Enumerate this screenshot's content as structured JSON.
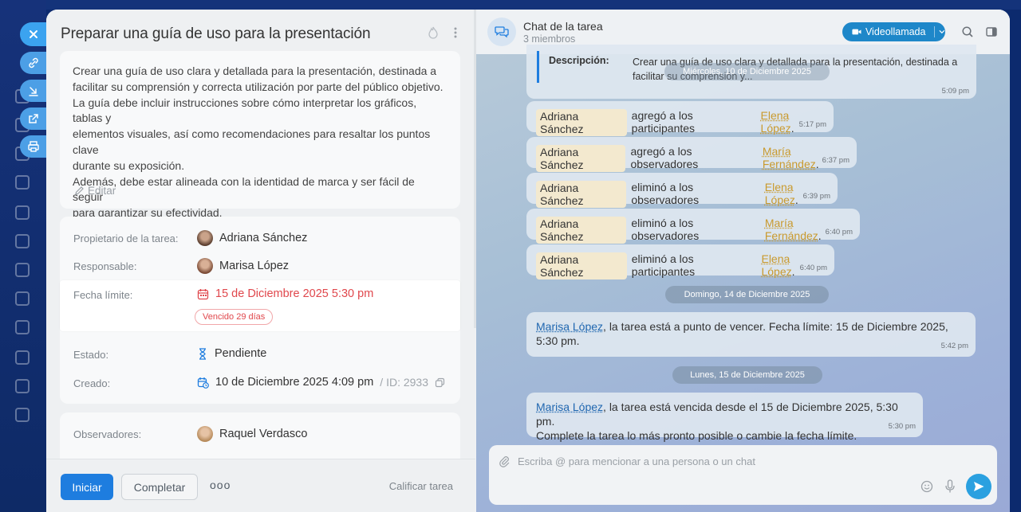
{
  "task": {
    "title": "Preparar una guía de uso para la presentación",
    "description": "Crear una guía de uso clara y detallada para la presentación, destinada a\nfacilitar su comprensión y correcta utilización por parte del público objetivo.\nLa guía debe incluir instrucciones sobre cómo interpretar los gráficos, tablas y\nelementos visuales, así como recomendaciones para resaltar los puntos clave\ndurante su exposición.\nAdemás, debe estar alineada con la identidad de marca y ser fácil de seguir\npara garantizar su efectividad.",
    "edit_label": "Editar",
    "fields": {
      "owner_label": "Propietario de la tarea:",
      "owner_value": "Adriana Sánchez",
      "responsible_label": "Responsable:",
      "responsible_value": "Marisa López",
      "deadline_label": "Fecha límite:",
      "deadline_value": "15 de Diciembre 2025 5:30 pm",
      "overdue_badge": "Vencido 29 días",
      "status_label": "Estado:",
      "status_value": "Pendiente",
      "created_label": "Creado:",
      "created_value": "10 de Diciembre 2025 4:09 pm",
      "created_id": "/ ID: 2933",
      "observers_label": "Observadores:",
      "observers_value": "Raquel Verdasco"
    },
    "footer": {
      "start": "Iniciar",
      "complete": "Completar",
      "more": "ooo",
      "rate": "Calificar tarea"
    }
  },
  "chat": {
    "title": "Chat de la tarea",
    "members": "3 miembros",
    "video_button": "Videollamada",
    "description_label": "Descripción:",
    "description_text": "Crear una guía de uso clara y detallada para la presentación, destinada a facilitar su comprensión y...",
    "description_time": "5:09 pm",
    "date_wednesday": "Miércoles, 10 de Diciembre 2025",
    "date_sunday": "Domingo, 14 de Diciembre 2025",
    "date_monday": "Lunes, 15 de Diciembre 2025",
    "system_messages": [
      {
        "actor": "Adriana Sánchez",
        "action": "agregó a los participantes",
        "target": "Elena López",
        "time": "5:17 pm"
      },
      {
        "actor": "Adriana Sánchez",
        "action": "agregó a los observadores",
        "target": "María Fernández",
        "time": "6:37 pm"
      },
      {
        "actor": "Adriana Sánchez",
        "action": "eliminó a los observadores",
        "target": "Elena López",
        "time": "6:39 pm"
      },
      {
        "actor": "Adriana Sánchez",
        "action": "eliminó a los observadores",
        "target": "María Fernández",
        "time": "6:40 pm"
      },
      {
        "actor": "Adriana Sánchez",
        "action": "eliminó a los participantes",
        "target": "Elena López",
        "time": "6:40 pm"
      }
    ],
    "msg_due_soon": {
      "name": "Marisa López",
      "text": ", la tarea está a punto de vencer. Fecha límite: 15 de Diciembre 2025, 5:30 pm.",
      "time": "5:42 pm"
    },
    "msg_overdue": {
      "name": "Marisa López",
      "text": ", la tarea está vencida desde el 15 de Diciembre 2025, 5:30 pm.",
      "text2": "Complete la tarea lo más pronto posible o cambie la fecha límite.",
      "time": "5:30 pm"
    },
    "composer_placeholder": "Escriba @ para mencionar a una persona o un chat"
  },
  "colors": {
    "accent": "#1e7ddf",
    "danger": "#e0474c",
    "mention": "#c99a2e"
  }
}
